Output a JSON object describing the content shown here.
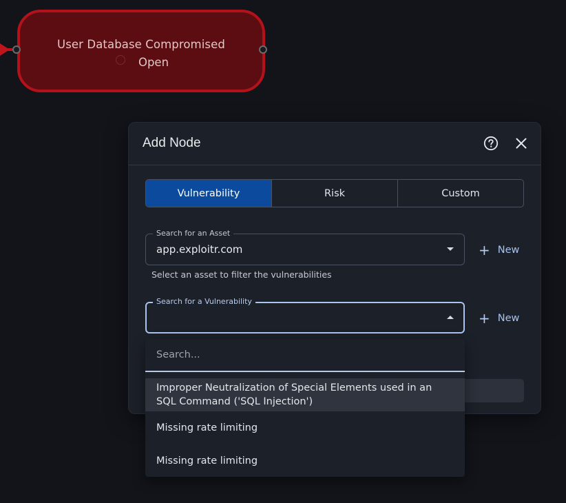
{
  "graph_node": {
    "title": "User Database Compromised",
    "status": "Open",
    "colors": {
      "border": "#b3121a",
      "fill": "#5c0d12"
    }
  },
  "dialog": {
    "title": "Add Node",
    "help_icon": "question-circle-icon",
    "close_icon": "close-icon"
  },
  "tabs": [
    {
      "label": "Vulnerability",
      "active": true
    },
    {
      "label": "Risk",
      "active": false
    },
    {
      "label": "Custom",
      "active": false
    }
  ],
  "asset_field": {
    "label": "Search for an Asset",
    "value": "app.exploitr.com",
    "helper": "Select an asset to filter the vulnerabilities"
  },
  "vulnerability_field": {
    "label": "Search for a Vulnerability",
    "value": ""
  },
  "new_button_label": "New",
  "dropdown": {
    "search_placeholder": "Search...",
    "options": [
      "Improper Neutralization of Special Elements used in an SQL Command ('SQL Injection')",
      "Missing rate limiting",
      "Missing rate limiting"
    ]
  },
  "colors": {
    "accent": "#0b4a9c",
    "link": "#a6c3f0",
    "background": "#12141a",
    "dialog": "#1c2029"
  }
}
